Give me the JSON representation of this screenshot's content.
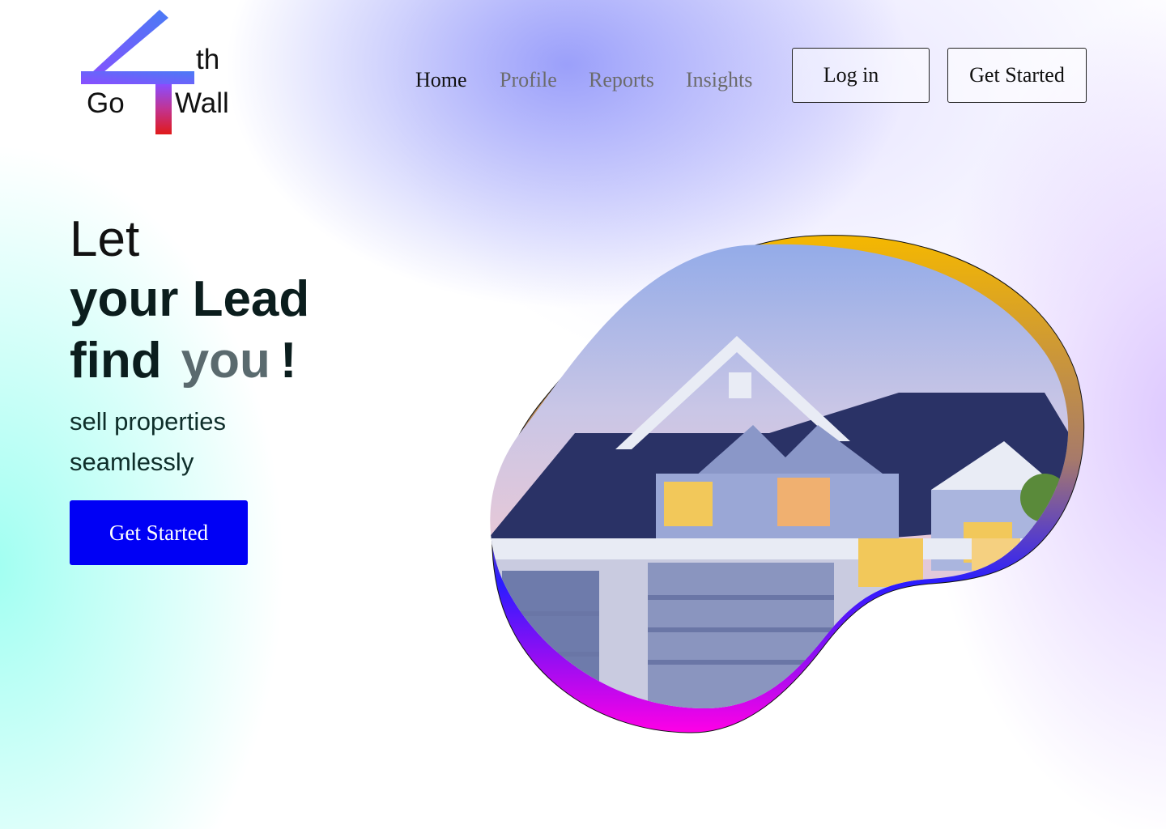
{
  "logo": {
    "numeral": "4",
    "word_left": "Go",
    "superscript": "th",
    "word_right": "Wall",
    "colors": {
      "gradient_start": "#8a4dff",
      "gradient_mid": "#4a7bf5",
      "stem_bottom": "#e01a1a"
    }
  },
  "nav": {
    "links": [
      {
        "label": "Home",
        "active": true
      },
      {
        "label": "Profile",
        "active": false
      },
      {
        "label": "Reports",
        "active": false
      },
      {
        "label": "Insights",
        "active": false
      }
    ],
    "login_label": "Log in",
    "get_started_label": "Get Started"
  },
  "hero": {
    "line1": "Let",
    "line2": "your Lead",
    "line3_word": "find",
    "line3_you": "you",
    "line3_punct": "!",
    "subtitle_line1": "sell properties",
    "subtitle_line2": "seamlessly",
    "cta_label": "Get Started",
    "image_subject": "house-photo",
    "colors": {
      "cta": "#0000f5",
      "blob_top": "#f5b800",
      "blob_bottom": "#ff00e6",
      "blob_left": "#2a1cff"
    }
  }
}
